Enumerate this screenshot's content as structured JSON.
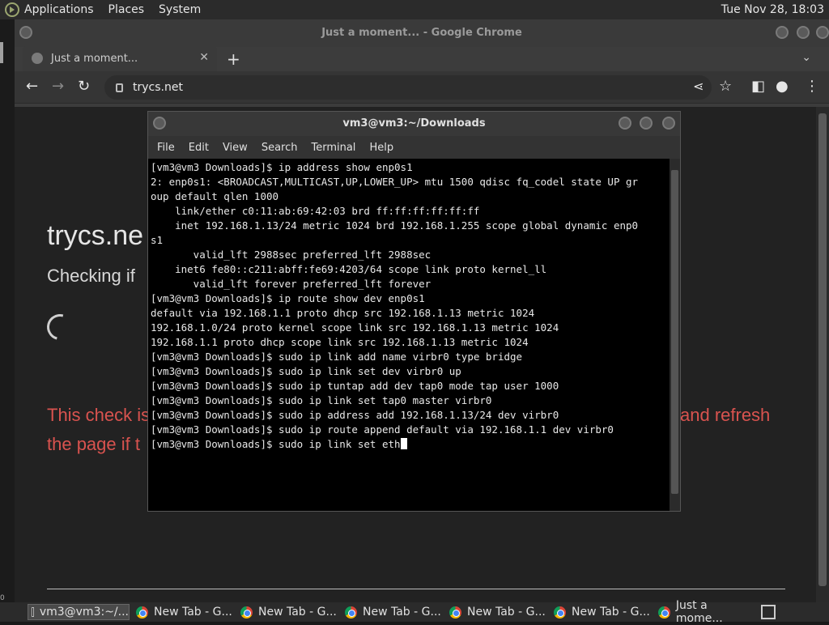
{
  "topbar": {
    "menus": [
      "Applications",
      "Places",
      "System"
    ],
    "clock": "Tue Nov 28, 18:03"
  },
  "chrome": {
    "window_title": "Just a moment... - Google Chrome",
    "tab_title": "Just a moment...",
    "url": "trycs.net",
    "page": {
      "title": "trycs.ne",
      "subtitle": "Checking if",
      "warning_line1_start": "This check is",
      "warning_line1_end": "and refresh",
      "warning_line2": "the page if t"
    }
  },
  "terminal": {
    "title": "vm3@vm3:~/Downloads",
    "menus": [
      "File",
      "Edit",
      "View",
      "Search",
      "Terminal",
      "Help"
    ],
    "lines": [
      "[vm3@vm3 Downloads]$ ip address show enp0s1",
      "2: enp0s1: <BROADCAST,MULTICAST,UP,LOWER_UP> mtu 1500 qdisc fq_codel state UP gr",
      "oup default qlen 1000",
      "    link/ether c0:11:ab:69:42:03 brd ff:ff:ff:ff:ff:ff",
      "    inet 192.168.1.13/24 metric 1024 brd 192.168.1.255 scope global dynamic enp0",
      "s1",
      "       valid_lft 2988sec preferred_lft 2988sec",
      "    inet6 fe80::c211:abff:fe69:4203/64 scope link proto kernel_ll",
      "       valid_lft forever preferred_lft forever",
      "[vm3@vm3 Downloads]$ ip route show dev enp0s1",
      "default via 192.168.1.1 proto dhcp src 192.168.1.13 metric 1024",
      "192.168.1.0/24 proto kernel scope link src 192.168.1.13 metric 1024",
      "192.168.1.1 proto dhcp scope link src 192.168.1.13 metric 1024",
      "[vm3@vm3 Downloads]$ sudo ip link add name virbr0 type bridge",
      "[vm3@vm3 Downloads]$ sudo ip link set dev virbr0 up",
      "[vm3@vm3 Downloads]$ sudo ip tuntap add dev tap0 mode tap user 1000",
      "[vm3@vm3 Downloads]$ sudo ip link set tap0 master virbr0",
      "[vm3@vm3 Downloads]$ sudo ip address add 192.168.1.13/24 dev virbr0",
      "[vm3@vm3 Downloads]$ sudo ip route append default via 192.168.1.1 dev virbr0"
    ],
    "current_line": "[vm3@vm3 Downloads]$ sudo ip link set eth"
  },
  "taskbar": {
    "items": [
      "vm3@vm3:~/...",
      "New Tab - G...",
      "New Tab - G...",
      "New Tab - G...",
      "New Tab - G...",
      "New Tab - G...",
      "Just a mome..."
    ]
  },
  "misc": {
    "left_edge_label": "0"
  }
}
